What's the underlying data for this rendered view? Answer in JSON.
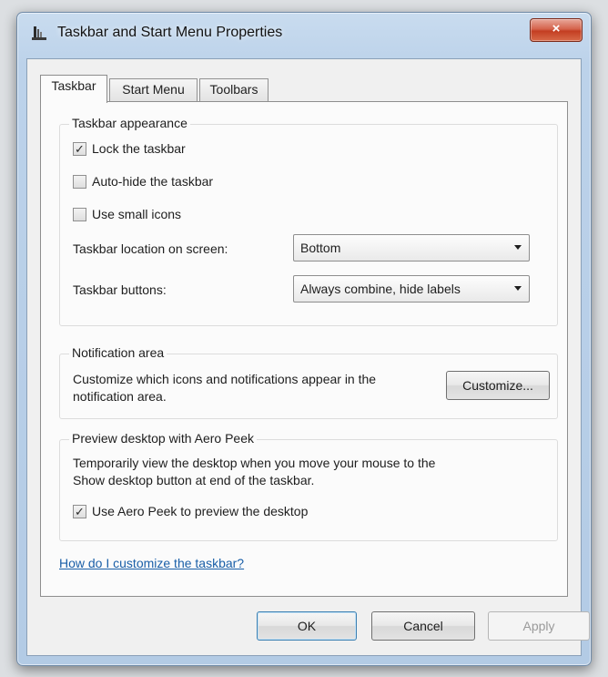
{
  "window": {
    "title": "Taskbar and Start Menu Properties",
    "close_glyph": "×"
  },
  "tabs": [
    {
      "label": "Taskbar",
      "active": true
    },
    {
      "label": "Start Menu",
      "active": false
    },
    {
      "label": "Toolbars",
      "active": false
    }
  ],
  "appearance": {
    "group_label": "Taskbar appearance",
    "lock_taskbar": {
      "label": "Lock the taskbar",
      "checked": true,
      "mark": "✓"
    },
    "auto_hide": {
      "label": "Auto-hide the taskbar",
      "checked": false,
      "mark": ""
    },
    "small_icons": {
      "label": "Use small icons",
      "checked": false,
      "mark": ""
    },
    "location_label": "Taskbar location on screen:",
    "location_value": "Bottom",
    "buttons_label": "Taskbar buttons:",
    "buttons_value": "Always combine, hide labels"
  },
  "notification": {
    "group_label": "Notification area",
    "text_line1": "Customize which icons and notifications appear in the",
    "text_line2": "notification area.",
    "customize_label": "Customize..."
  },
  "peek": {
    "group_label": "Preview desktop with Aero Peek",
    "text_line1": "Temporarily view the desktop when you move your mouse to the",
    "text_line2": "Show desktop button at end of the taskbar.",
    "use_peek": {
      "label": "Use Aero Peek to preview the desktop",
      "checked": true,
      "mark": "✓"
    }
  },
  "help_link": "How do I customize the taskbar?",
  "buttons": {
    "ok": "OK",
    "cancel": "Cancel",
    "apply": "Apply"
  },
  "colors": {
    "link": "#1a5fa8",
    "close_button": "#c33e22",
    "frame": "#b3cbe5"
  }
}
